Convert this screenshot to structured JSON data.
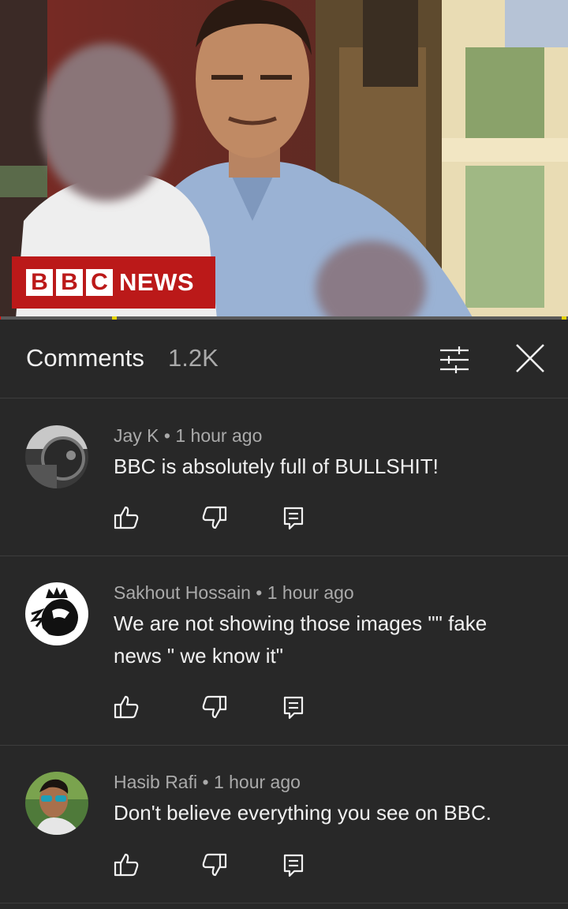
{
  "video": {
    "badge_brand": "BBC",
    "badge_suffix": "NEWS",
    "progress_fraction": 0.2
  },
  "comments_panel": {
    "title": "Comments",
    "count": "1.2K"
  },
  "comments": [
    {
      "author": "Jay K",
      "time": "1 hour ago",
      "text": "BBC is absolutely full of BULLSHIT!"
    },
    {
      "author": "Sakhout Hossain",
      "time": "1 hour ago",
      "text": "We are not showing those images \"\" fake news \" we know it\""
    },
    {
      "author": "Hasib Rafi",
      "time": "1 hour ago",
      "text": "Don't believe everything you see on BBC."
    }
  ],
  "colors": {
    "background": "#282828",
    "divider": "#3d3d3d",
    "secondary_text": "#aaaaaa",
    "primary_text": "#f1f1f1",
    "bbc_red": "#bb1919",
    "progress_red": "#ff0000"
  },
  "icons": [
    "filter-icon",
    "close-icon",
    "thumbs-up-icon",
    "thumbs-down-icon",
    "reply-icon"
  ]
}
